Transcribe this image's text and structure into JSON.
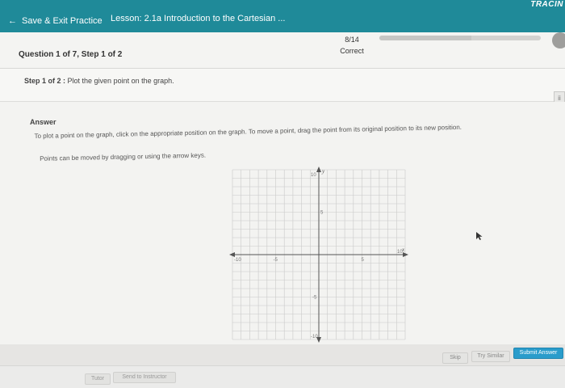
{
  "header": {
    "back_arrow": "←",
    "back_label": "Save & Exit Practice",
    "lesson_title": "Lesson: 2.1a Introduction to the Cartesian ...",
    "brand": "TRACIN"
  },
  "question_bar": {
    "question_label": "Question 1 of 7,  Step 1 of 2",
    "score": "8/14",
    "status": "Correct",
    "progress_fraction": 0.57
  },
  "step": {
    "prefix": "Step 1 of 2 :",
    "text": "Plot the given point on the graph."
  },
  "side_icon": "ii",
  "answer": {
    "title": "Answer",
    "instruction": "To plot a point on the graph, click on the appropriate position on the graph. To move a point, drag the point from its original position to its new position.",
    "hint": "Points can be moved by dragging or using the arrow keys."
  },
  "graph": {
    "x_axis_label": "x",
    "y_axis_label": "y",
    "xmin": -10,
    "xmax": 10,
    "ymin": -10,
    "ymax": 10,
    "tick_labels": {
      "x_min": "-10",
      "x_neg_mid": "-5",
      "x_pos_mid": "5",
      "x_max": "10",
      "y_max": "10",
      "y_pos_mid": "5",
      "y_neg_mid": "-5",
      "y_min": "-10"
    }
  },
  "buttons": {
    "skip": "Skip",
    "try_similar": "Try Similar",
    "submit": "Submit Answer",
    "tutor": "Tutor",
    "send": "Send to Instructor"
  }
}
